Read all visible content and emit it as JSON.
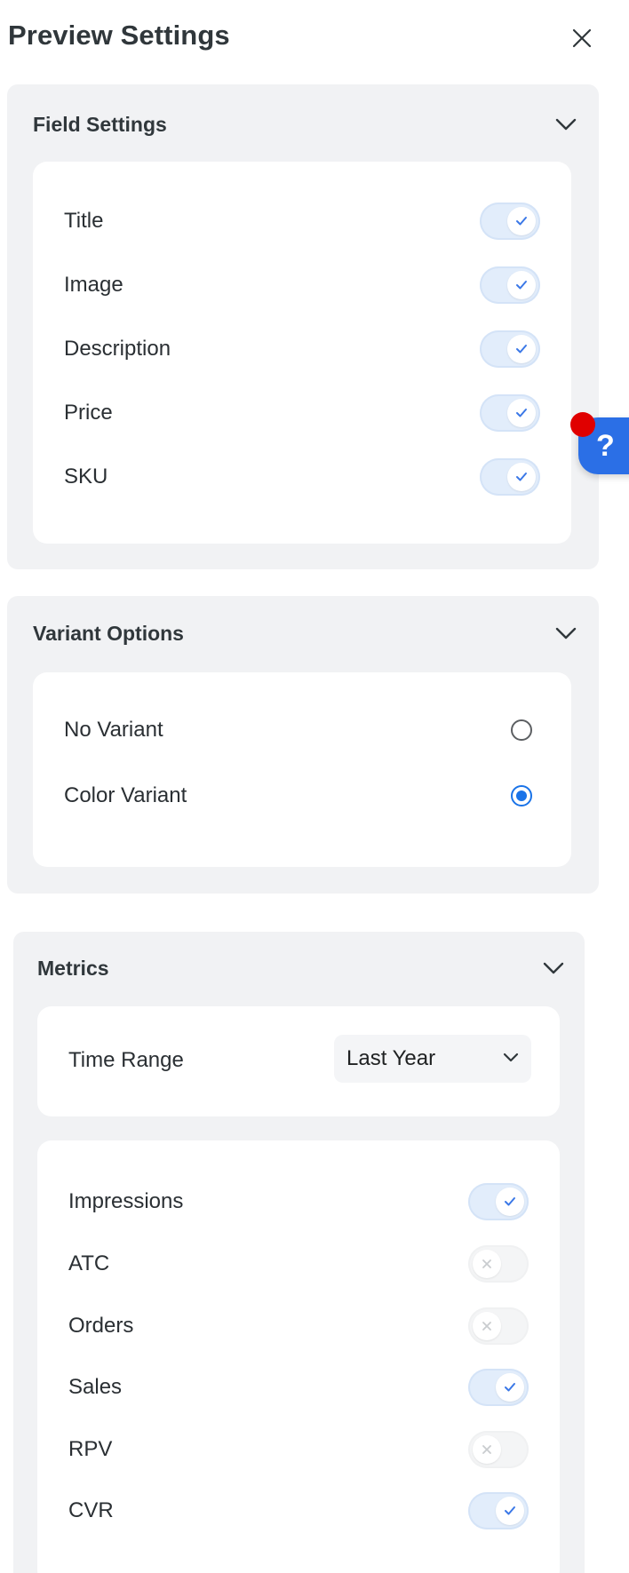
{
  "header": {
    "title": "Preview Settings",
    "close_icon": "close-icon"
  },
  "field_settings": {
    "title": "Field Settings",
    "items": [
      {
        "label": "Title",
        "enabled": true
      },
      {
        "label": "Image",
        "enabled": true
      },
      {
        "label": "Description",
        "enabled": true
      },
      {
        "label": "Price",
        "enabled": true
      },
      {
        "label": "SKU",
        "enabled": true
      }
    ]
  },
  "variant_options": {
    "title": "Variant Options",
    "options": [
      {
        "label": "No Variant",
        "selected": false
      },
      {
        "label": "Color Variant",
        "selected": true
      }
    ]
  },
  "metrics": {
    "title": "Metrics",
    "time_range": {
      "label": "Time Range",
      "value": "Last Year"
    },
    "items": [
      {
        "label": "Impressions",
        "enabled": true
      },
      {
        "label": "ATC",
        "enabled": false
      },
      {
        "label": "Orders",
        "enabled": false
      },
      {
        "label": "Sales",
        "enabled": true
      },
      {
        "label": "RPV",
        "enabled": false
      },
      {
        "label": "CVR",
        "enabled": true
      }
    ]
  },
  "help": {
    "label": "?"
  },
  "colors": {
    "accent": "#1a73e8",
    "help_button": "#2b6fe6",
    "notification_dot": "#e00000",
    "section_bg": "#f1f2f4"
  }
}
